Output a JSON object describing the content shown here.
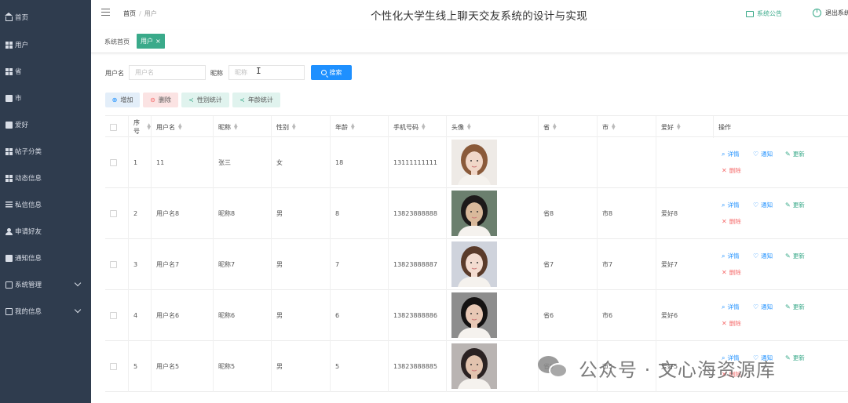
{
  "sidebar": {
    "items": [
      {
        "label": "首页",
        "icon": "home-icon"
      },
      {
        "label": "用户",
        "icon": "grid-icon"
      },
      {
        "label": "省",
        "icon": "grid-icon"
      },
      {
        "label": "市",
        "icon": "box-icon"
      },
      {
        "label": "爱好",
        "icon": "box-icon"
      },
      {
        "label": "帖子分类",
        "icon": "grid-icon"
      },
      {
        "label": "动态信息",
        "icon": "grid-icon"
      },
      {
        "label": "私信信息",
        "icon": "list-icon"
      },
      {
        "label": "申请好友",
        "icon": "user-icon"
      },
      {
        "label": "通知信息",
        "icon": "box-icon"
      },
      {
        "label": "系统管理",
        "icon": "bag-icon",
        "has_children": true
      },
      {
        "label": "我的信息",
        "icon": "bag-icon",
        "has_children": true
      }
    ],
    "bg_color": "#2f3c4e"
  },
  "header": {
    "breadcrumb_home": "首页",
    "breadcrumb_sep": "/",
    "breadcrumb_current": "用户",
    "title": "个性化大学生线上聊天交友系统的设计与实现",
    "notice_label": "系统公告",
    "logout_label": "退出系统"
  },
  "tabs": {
    "home": "系统首页",
    "active": "用户",
    "active_close": "×",
    "accent_color": "#3aaa8a"
  },
  "search": {
    "username_label": "用户名",
    "username_placeholder": "用户名",
    "nickname_label": "昵称",
    "nickname_placeholder": "昵称",
    "button_label": "搜索",
    "button_color": "#1e90ff"
  },
  "actions": {
    "add": "增加",
    "delete": "删除",
    "gender_stats": "性别统计",
    "age_stats": "年龄统计"
  },
  "table": {
    "columns": [
      "序号",
      "用户名",
      "昵称",
      "性别",
      "年龄",
      "手机号码",
      "头像",
      "省",
      "市",
      "爱好",
      "操作"
    ],
    "sortable": [
      true,
      true,
      true,
      true,
      true,
      true,
      true,
      true,
      true,
      true,
      false
    ],
    "op_labels": {
      "detail": "详情",
      "notify": "通知",
      "update": "更新",
      "delete": "删除"
    },
    "rows": [
      {
        "idx": "1",
        "username": "11",
        "nickname": "张三",
        "gender": "女",
        "age": "18",
        "phone": "13111111111",
        "province": "",
        "city": "",
        "hobby": ""
      },
      {
        "idx": "2",
        "username": "用户名8",
        "nickname": "昵称8",
        "gender": "男",
        "age": "8",
        "phone": "13823888888",
        "province": "省8",
        "city": "市8",
        "hobby": "爱好8"
      },
      {
        "idx": "3",
        "username": "用户名7",
        "nickname": "昵称7",
        "gender": "男",
        "age": "7",
        "phone": "13823888887",
        "province": "省7",
        "city": "市7",
        "hobby": "爱好7"
      },
      {
        "idx": "4",
        "username": "用户名6",
        "nickname": "昵称6",
        "gender": "男",
        "age": "6",
        "phone": "13823888886",
        "province": "省6",
        "city": "市6",
        "hobby": "爱好6"
      },
      {
        "idx": "5",
        "username": "用户名5",
        "nickname": "昵称5",
        "gender": "男",
        "age": "5",
        "phone": "13823888885",
        "province": "省5",
        "city": "市5",
        "hobby": "爱好5"
      }
    ]
  },
  "watermark": {
    "text": "公众号 · 文心海资源库"
  }
}
